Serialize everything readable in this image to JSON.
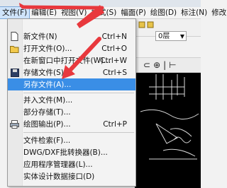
{
  "menubar": {
    "items": [
      {
        "label": "文件(F)"
      },
      {
        "label": "编辑(E)"
      },
      {
        "label": "视图(V)"
      },
      {
        "label": "格式(S)"
      },
      {
        "label": "幅面(P)"
      },
      {
        "label": "绘图(D)"
      },
      {
        "label": "标注(N)"
      },
      {
        "label": "修改"
      }
    ]
  },
  "toolbar": {
    "layer_value": "0层"
  },
  "file_menu": {
    "items": [
      {
        "label": "新文件(N)",
        "shortcut": "Ctrl+N",
        "icon": "new-file-icon"
      },
      {
        "label": "打开文件(O)...",
        "shortcut": "Ctrl+O",
        "icon": "open-folder-icon"
      },
      {
        "label": "在新窗口中打开文件(W)...",
        "shortcut": "Ctrl+W",
        "icon": ""
      },
      {
        "label": "存储文件(S)",
        "shortcut": "Ctrl+S",
        "icon": "save-icon"
      },
      {
        "label": "另存文件(A)...",
        "shortcut": "",
        "icon": ""
      },
      {
        "label": "并入文件(M)...",
        "shortcut": "",
        "icon": ""
      },
      {
        "label": "部分存储(T)...",
        "shortcut": "",
        "icon": ""
      },
      {
        "label": "绘图输出(P)...",
        "shortcut": "Ctrl+P",
        "icon": "print-icon"
      },
      {
        "label": "文件检索(F)...",
        "shortcut": "",
        "icon": ""
      },
      {
        "label": "DWG/DXF批转换器(B)...",
        "shortcut": "",
        "icon": ""
      },
      {
        "label": "应用程序管理器(L)...",
        "shortcut": "",
        "icon": ""
      },
      {
        "label": "实体设计数据接口(D)",
        "shortcut": "",
        "icon": ""
      }
    ]
  },
  "colors": {
    "highlight": "#3a8ee6",
    "annotation_arrow": "#e8383d",
    "canvas": "#000000"
  }
}
